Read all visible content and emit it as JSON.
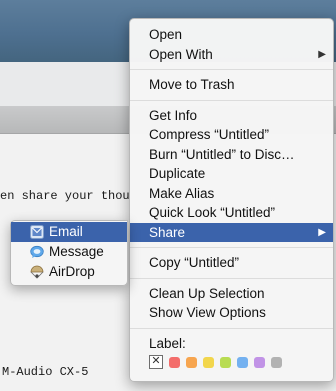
{
  "background": {
    "text_line": "en share your thou",
    "device_label": "M-Audio CX-5"
  },
  "context_menu": {
    "items": [
      {
        "label": "Open"
      },
      {
        "label": "Open With",
        "has_submenu": true
      },
      {
        "separator": true
      },
      {
        "label": "Move to Trash"
      },
      {
        "separator": true
      },
      {
        "label": "Get Info"
      },
      {
        "label": "Compress “Untitled”"
      },
      {
        "label": "Burn “Untitled” to Disc…"
      },
      {
        "label": "Duplicate"
      },
      {
        "label": "Make Alias"
      },
      {
        "label": "Quick Look “Untitled”"
      },
      {
        "label": "Share",
        "has_submenu": true,
        "highlighted": true
      },
      {
        "separator": true
      },
      {
        "label": "Copy “Untitled”"
      },
      {
        "separator": true
      },
      {
        "label": "Clean Up Selection"
      },
      {
        "label": "Show View Options"
      },
      {
        "separator": true
      },
      {
        "label": "Label:"
      }
    ],
    "submenu_arrow": "▶",
    "label_colors": [
      "#f36d6b",
      "#f7a54f",
      "#f2d64c",
      "#b8dc52",
      "#74b1f0",
      "#c193e6",
      "#b2b2b2"
    ],
    "label_none_glyph": "✕"
  },
  "share_submenu": {
    "items": [
      {
        "label": "Email",
        "icon": "mail-icon",
        "highlighted": true
      },
      {
        "label": "Message",
        "icon": "messages-icon"
      },
      {
        "label": "AirDrop",
        "icon": "airdrop-icon"
      }
    ]
  }
}
